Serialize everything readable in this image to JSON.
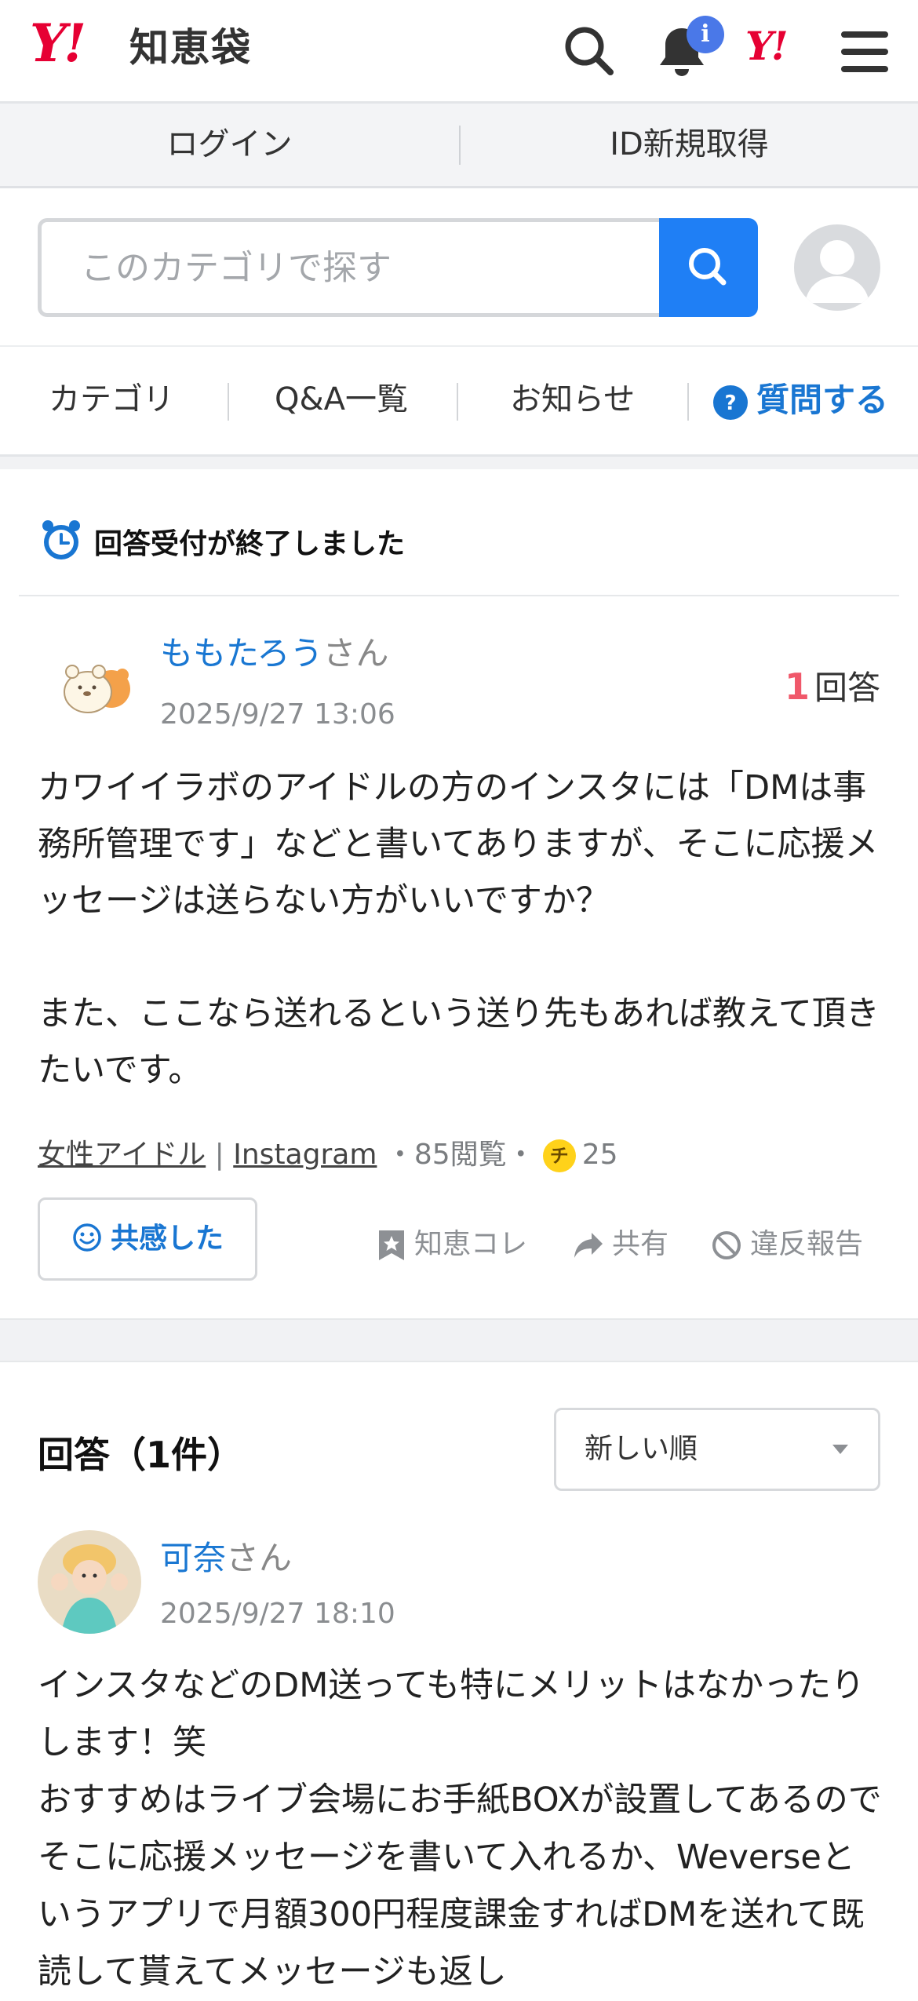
{
  "header": {
    "logo_mark": "Y!",
    "logo_text": "知恵袋",
    "notification_badge": "i",
    "yahoo_mark": "Y!",
    "icons": [
      "search-icon",
      "bell-icon",
      "yahoo-logo",
      "menu-icon"
    ]
  },
  "login_bar": {
    "login": "ログイン",
    "signup": "ID新規取得"
  },
  "search": {
    "placeholder": "このカテゴリで探す"
  },
  "nav": {
    "category": "カテゴリ",
    "qa_list": "Q&A一覧",
    "news": "お知らせ",
    "ask": "質問する"
  },
  "question": {
    "status": "回答受付が終了しました",
    "user_name": "ももたろう",
    "user_suffix": "さん",
    "date": "2025/9/27 13:06",
    "answer_count": "1",
    "answer_label": "回答",
    "body": "カワイイラボのアイドルの方のインスタには「DMは事務所管理です」などと書いてありますが、そこに応援メッセージは送らない方がいいですか？\n\nまた、ここなら送れるという送り先もあれば教えて頂きたいです。",
    "tags": [
      "女性アイドル",
      "Instagram"
    ],
    "tag_sep": "|",
    "views": "85閲覧",
    "coin_mark": "チ",
    "coins": "25",
    "empathy_label": "共感した",
    "save_label": "知恵コレ",
    "share_label": "共有",
    "report_label": "違反報告"
  },
  "answers": {
    "title": "回答（1件）",
    "sort_selected": "新しい順",
    "items": [
      {
        "user_name": "可奈",
        "user_suffix": "さん",
        "date": "2025/9/27 18:10",
        "body": "インスタなどのDM送っても特にメリットはなかったりします！笑\nおすすめはライブ会場にお手紙BOXが設置してあるのでそこに応援メッセージを書いて入れるか、Weverseというアプリで月額300円程度課金すればDMを送れて既読して貰えてメッセージも返し"
      }
    ]
  },
  "colors": {
    "brand_red": "#e60033",
    "link_blue": "#1977d2",
    "search_blue": "#1f7ff5",
    "answer_count_red": "#f0586a"
  }
}
